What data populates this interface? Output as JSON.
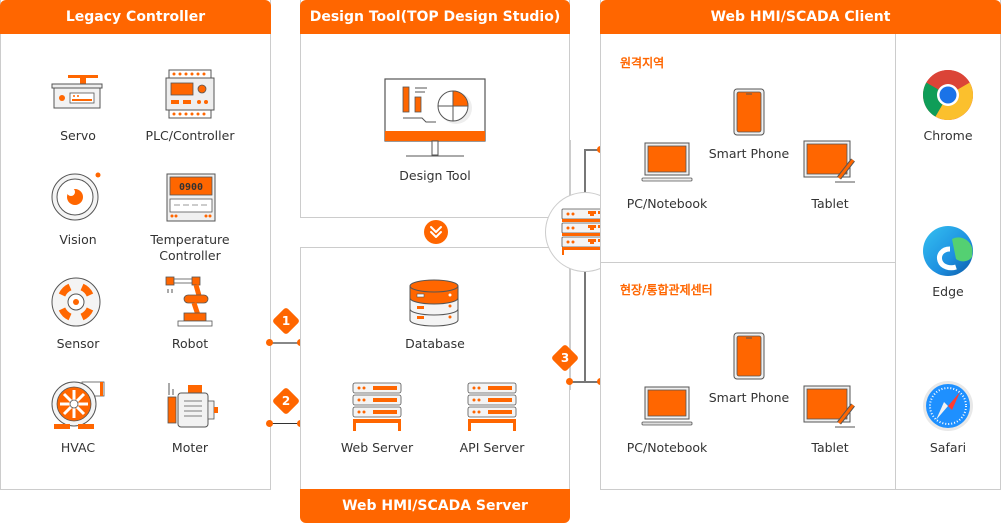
{
  "legacy": {
    "title": "Legacy Controller",
    "items": [
      {
        "label": "Servo",
        "icon": "servo-icon"
      },
      {
        "label": "PLC/Controller",
        "icon": "plc-icon"
      },
      {
        "label": "Vision",
        "icon": "vision-camera-icon"
      },
      {
        "label": "Temperature",
        "label2": "Controller",
        "icon": "temperature-controller-icon",
        "display": "0900"
      },
      {
        "label": "Sensor",
        "icon": "sensor-icon"
      },
      {
        "label": "Robot",
        "icon": "robot-arm-icon"
      },
      {
        "label": "HVAC",
        "icon": "hvac-fan-icon"
      },
      {
        "label": "Moter",
        "icon": "motor-icon"
      }
    ]
  },
  "design": {
    "title": "Design Tool(TOP Design Studio)",
    "item_label": "Design Tool"
  },
  "server": {
    "title": "Web HMI/SCADA Server",
    "database_label": "Database",
    "web_server_label": "Web Server",
    "api_server_label": "API Server"
  },
  "client": {
    "title": "Web HMI/SCADA Client",
    "remote": {
      "title": "원격지역",
      "pc_label": "PC/Notebook",
      "phone_label": "Smart Phone",
      "tablet_label": "Tablet"
    },
    "onsite": {
      "title": "현장/통합관제센터",
      "pc_label": "PC/Notebook",
      "phone_label": "Smart Phone",
      "tablet_label": "Tablet"
    },
    "browsers": [
      {
        "label": "Chrome",
        "icon": "chrome-icon"
      },
      {
        "label": "Edge",
        "icon": "edge-icon"
      },
      {
        "label": "Safari",
        "icon": "safari-icon"
      }
    ]
  },
  "connectors": {
    "badges": [
      "1",
      "2",
      "3"
    ]
  },
  "colors": {
    "accent": "#ff6600",
    "border": "#cccccc",
    "text": "#333333"
  }
}
